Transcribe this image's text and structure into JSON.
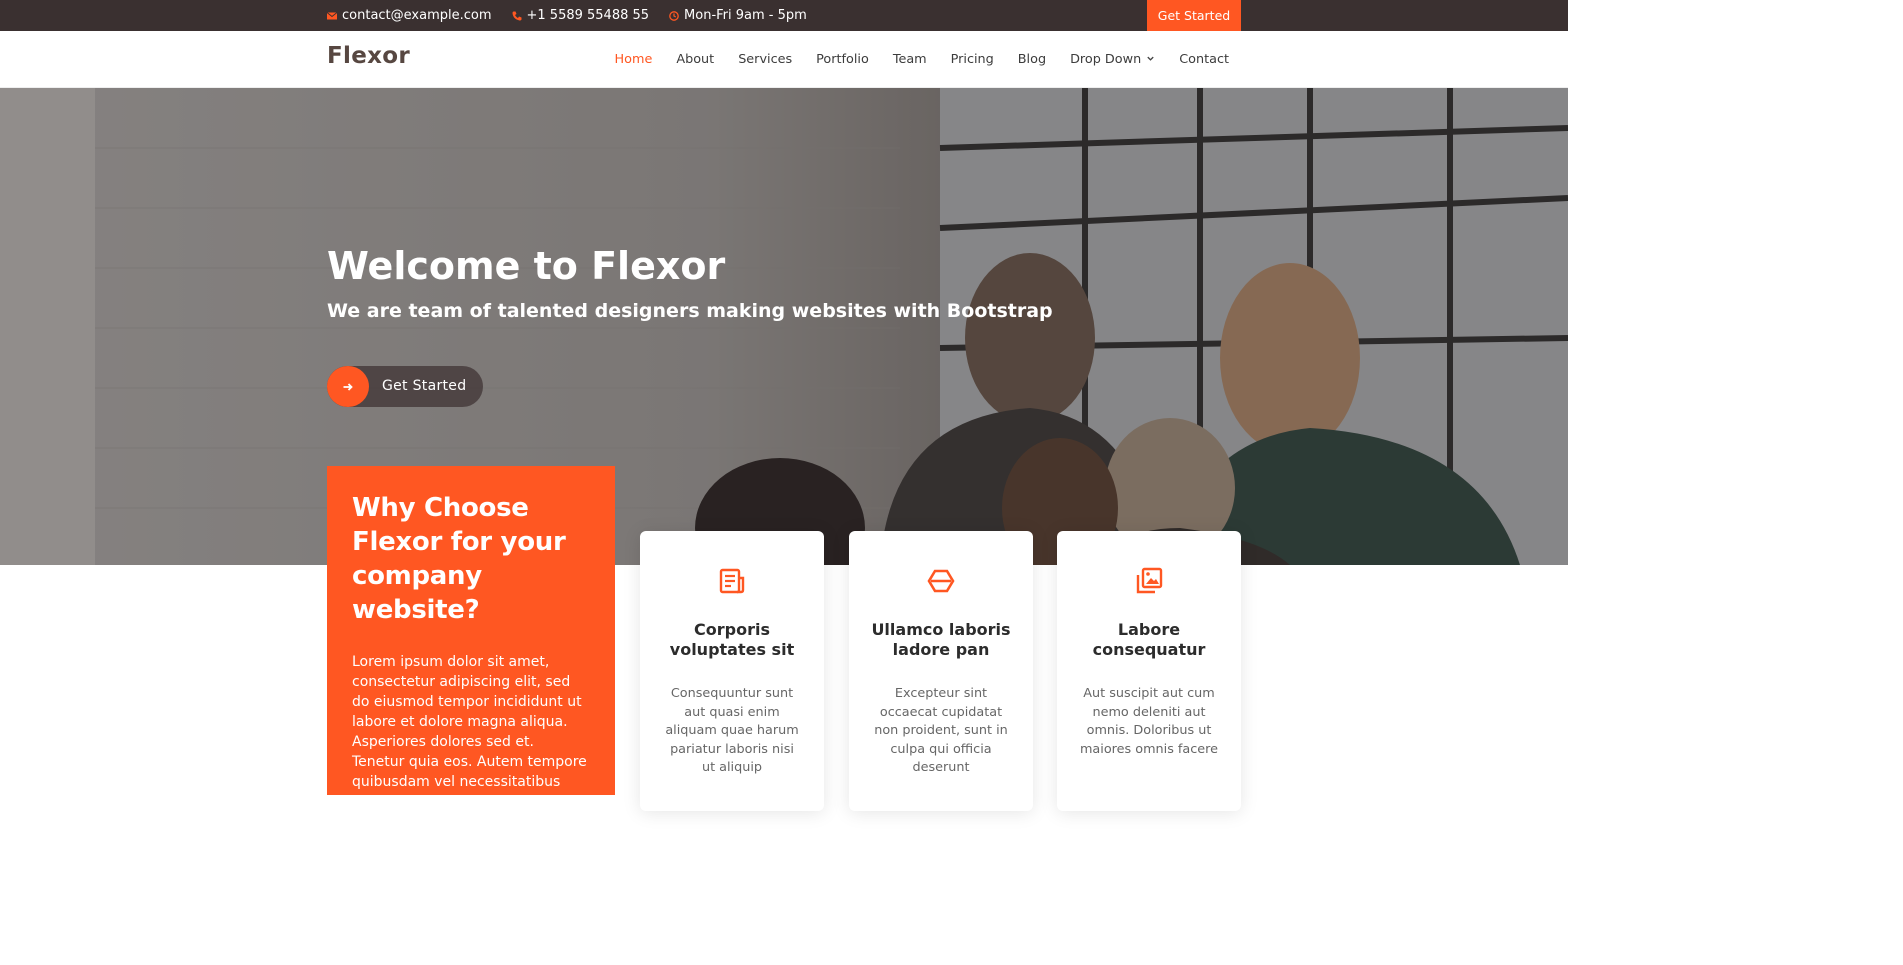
{
  "topbar": {
    "email": "contact@example.com",
    "phone": "+1 5589 55488 55",
    "hours": "Mon-Fri 9am - 5pm",
    "cta_label": "Get Started",
    "icons": {
      "email": "envelope-icon",
      "phone": "phone-icon",
      "hours": "clock-icon"
    }
  },
  "header": {
    "logo": "Flexor",
    "nav": [
      {
        "label": "Home",
        "active": true
      },
      {
        "label": "About"
      },
      {
        "label": "Services"
      },
      {
        "label": "Portfolio"
      },
      {
        "label": "Team"
      },
      {
        "label": "Pricing"
      },
      {
        "label": "Blog"
      },
      {
        "label": "Drop Down",
        "icon": "chevron-down-icon"
      },
      {
        "label": "Contact"
      }
    ]
  },
  "hero": {
    "title": "Welcome to Flexor",
    "subtitle": "We are team of talented designers making websites with Bootstrap",
    "button_label": "Get Started",
    "button_icon": "arrow-right-icon"
  },
  "why": {
    "title": "Why Choose Flexor for your company website?",
    "text": "Lorem ipsum dolor sit amet, consectetur adipiscing elit, sed do eiusmod tempor incididunt ut labore et dolore magna aliqua. Asperiores dolores sed et. Tenetur quia eos. Autem tempore quibusdam vel necessitatibus optio ad corporis."
  },
  "cards": [
    {
      "icon": "receipt-icon",
      "title": "Corporis voluptates sit",
      "text": "Consequuntur sunt aut quasi enim aliquam quae harum pariatur laboris nisi ut aliquip"
    },
    {
      "icon": "cube-icon",
      "title": "Ullamco laboris ladore pan",
      "text": "Excepteur sint occaecat cupidatat non proident, sunt in culpa qui officia deserunt"
    },
    {
      "icon": "images-icon",
      "title": "Labore consequatur",
      "text": "Aut suscipit aut cum nemo deleniti aut omnis. Doloribus ut maiores omnis facere"
    }
  ],
  "colors": {
    "accent": "#ff5722",
    "topbar": "#3a3030",
    "logo": "#574741"
  }
}
